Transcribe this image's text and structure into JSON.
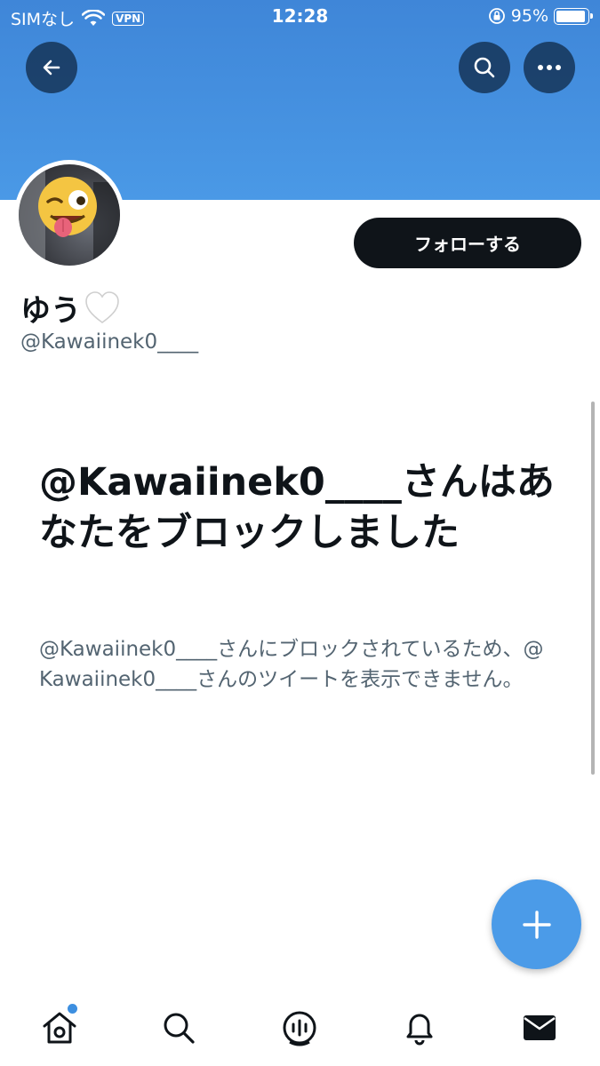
{
  "status_bar": {
    "carrier": "SIMなし",
    "vpn": "VPN",
    "time": "12:28",
    "battery_percent": "95%",
    "battery_level": 0.95
  },
  "header": {
    "back_icon": "arrow-left-icon",
    "search_icon": "search-icon",
    "more_icon": "more-horizontal-icon",
    "banner_color": "#4a99e6"
  },
  "profile": {
    "display_name": "ゆう",
    "name_emoji": "white-heart-icon",
    "handle": "@Kawaiinek0____",
    "follow_label": "フォローする"
  },
  "blocked": {
    "title": "@Kawaiinek0____さんはあなたをブロックしました",
    "description": "@Kawaiinek0____さんにブロックされているため、@Kawaiinek0____さんのツイートを表示できません。"
  },
  "fab": {
    "icon": "plus-icon",
    "color": "#4b9be8"
  },
  "tabbar": {
    "items": [
      {
        "icon": "home-icon",
        "has_badge": true
      },
      {
        "icon": "search-icon"
      },
      {
        "icon": "spaces-icon"
      },
      {
        "icon": "bell-icon"
      },
      {
        "icon": "mail-icon"
      }
    ]
  }
}
